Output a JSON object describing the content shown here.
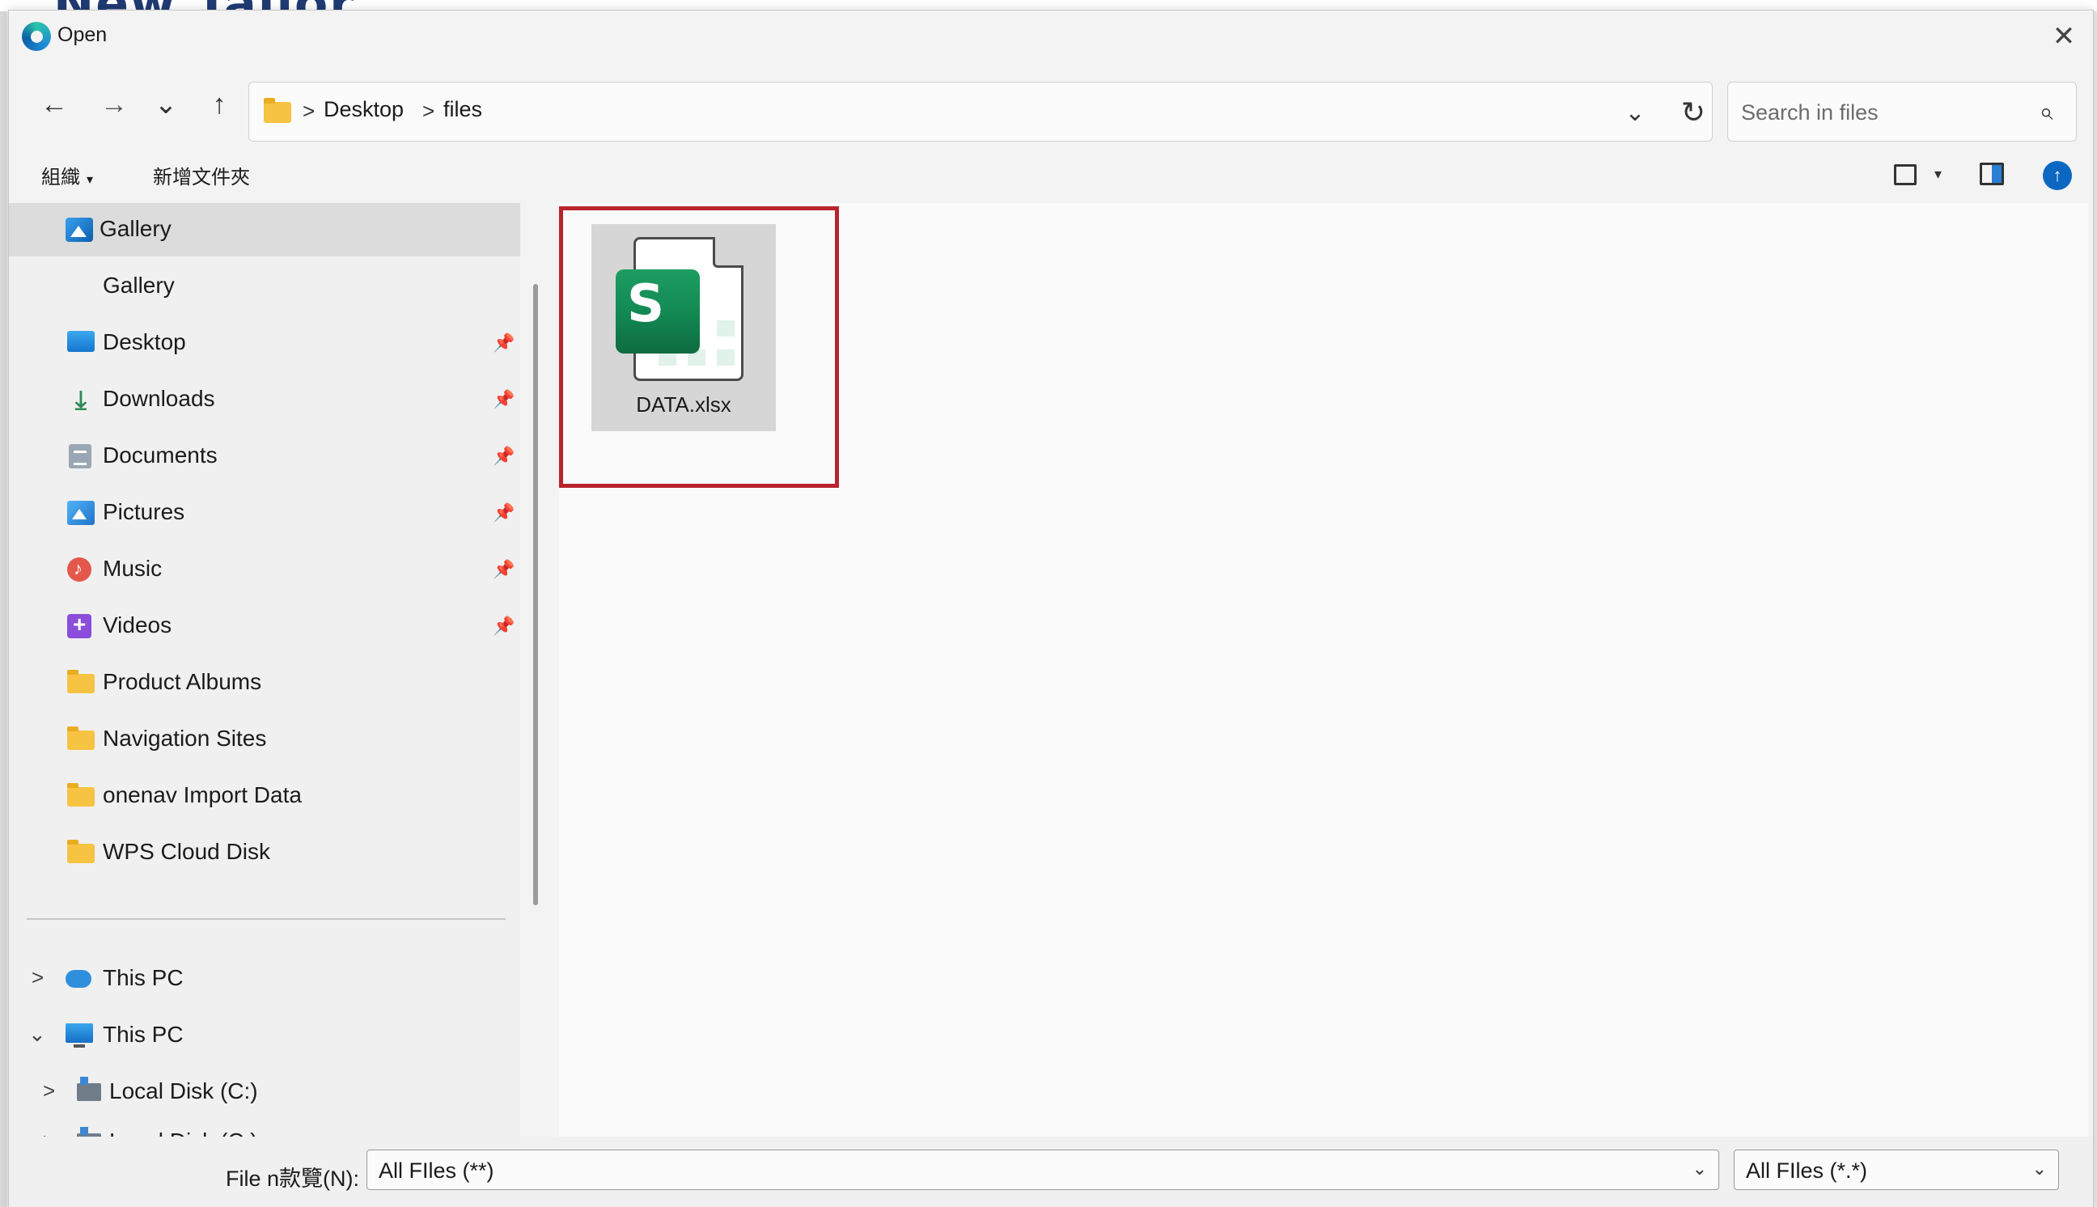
{
  "background_app": {
    "heading_partial": "New Tallor"
  },
  "dialog": {
    "title": "Open",
    "close_symbol": "✕"
  },
  "nav": {
    "back_icon": "arrow-left-icon",
    "forward_icon": "arrow-right-icon",
    "recent_icon": "chevron-down-icon",
    "up_icon": "arrow-up-icon",
    "back_symbol": "←",
    "forward_symbol": "→",
    "recent_symbol": "⌄",
    "up_symbol": "↑"
  },
  "address": {
    "separator": ">",
    "crumbs": [
      "Desktop",
      "files"
    ],
    "dropdown_symbol": "⌄",
    "refresh_symbol": "↻"
  },
  "search": {
    "placeholder": "Search in files",
    "icon_symbol": "⌕"
  },
  "commandbar": {
    "organize_label": "組織",
    "organize_caret": "▾",
    "new_folder_label": "新增文件夾",
    "view_caret": "▾",
    "help_symbol": "↑"
  },
  "sidebar": {
    "pin_symbol": "📌",
    "items": [
      {
        "label": "Gallery",
        "icon": "gallery-icon",
        "selected": true
      },
      {
        "label": "Gallery",
        "icon": "none"
      },
      {
        "label": "Desktop",
        "icon": "desktop-icon",
        "pinned": true
      },
      {
        "label": "Downloads",
        "icon": "download-icon",
        "pinned": true
      },
      {
        "label": "Documents",
        "icon": "document-icon",
        "pinned": true
      },
      {
        "label": "Pictures",
        "icon": "pictures-icon",
        "pinned": true
      },
      {
        "label": "Music",
        "icon": "music-icon",
        "pinned": true
      },
      {
        "label": "Videos",
        "icon": "videos-icon",
        "pinned": true
      },
      {
        "label": "Product Albums",
        "icon": "folder-icon"
      },
      {
        "label": "Navigation Sites",
        "icon": "folder-icon"
      },
      {
        "label": "onenav Import Data",
        "icon": "folder-icon"
      },
      {
        "label": "WPS Cloud Disk",
        "icon": "folder-icon"
      }
    ],
    "tree": [
      {
        "label": "This PC",
        "icon": "cloud-icon",
        "expander": ">"
      },
      {
        "label": "This PC",
        "icon": "computer-icon",
        "expander": "⌄"
      },
      {
        "label": "Local Disk (C:)",
        "icon": "disk-icon",
        "expander": ">"
      },
      {
        "label": "Local Disk (C:)",
        "icon": "disk-icon",
        "expander": ">"
      }
    ]
  },
  "content": {
    "files": [
      {
        "name": "DATA.xlsx",
        "icon": "spreadsheet-icon",
        "badge_letter": "S",
        "highlighted": true
      }
    ]
  },
  "bottom": {
    "filename_label": "File n款覽(N):",
    "filename_value": "All FIles (**)",
    "filetype_value": "All FIles (*.*)",
    "caret_symbol": "⌄"
  },
  "colors": {
    "highlight": "#b8232e",
    "accent": "#0b67c2",
    "spreadsheet_green": "#138a54",
    "folder_yellow": "#f6c342"
  }
}
